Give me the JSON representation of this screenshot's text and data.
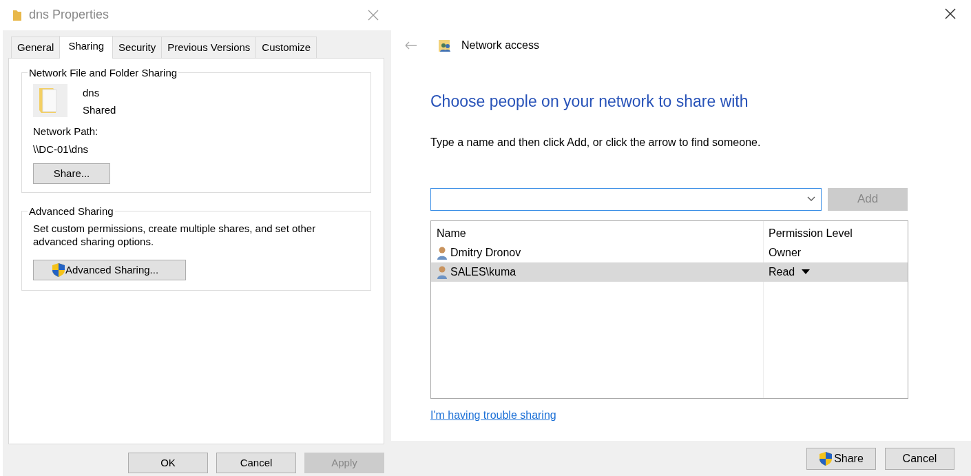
{
  "properties_window": {
    "title": "dns Properties",
    "tabs": [
      {
        "label": "General",
        "selected": false
      },
      {
        "label": "Sharing",
        "selected": true
      },
      {
        "label": "Security",
        "selected": false
      },
      {
        "label": "Previous Versions",
        "selected": false
      },
      {
        "label": "Customize",
        "selected": false
      }
    ],
    "network_sharing": {
      "legend": "Network File and Folder Sharing",
      "folder_name": "dns",
      "folder_state": "Shared",
      "path_label": "Network Path:",
      "path": "\\\\DC-01\\dns",
      "share_button": "Share..."
    },
    "advanced_sharing": {
      "legend": "Advanced Sharing",
      "description": "Set custom permissions, create multiple shares, and set other advanced sharing options.",
      "button": "Advanced Sharing..."
    },
    "buttons": [
      {
        "label": "OK",
        "disabled": false
      },
      {
        "label": "Cancel",
        "disabled": false
      },
      {
        "label": "Apply",
        "disabled": true
      }
    ]
  },
  "network_access": {
    "title": "Network access",
    "heading": "Choose people on your network to share with",
    "instruction": "Type a name and then click Add, or click the arrow to find someone.",
    "add_button": {
      "label": "Add",
      "disabled": true
    },
    "table": {
      "columns": [
        "Name",
        "Permission Level"
      ],
      "rows": [
        {
          "name": "Dmitry Dronov",
          "permission": "Owner",
          "selected": false
        },
        {
          "name": "SALES\\kuma",
          "permission": "Read",
          "selected": true
        }
      ]
    },
    "help_link": "I'm having trouble sharing",
    "buttons": [
      {
        "label": "Share",
        "kind": "shield"
      },
      {
        "label": "Cancel",
        "kind": "plain"
      }
    ]
  }
}
